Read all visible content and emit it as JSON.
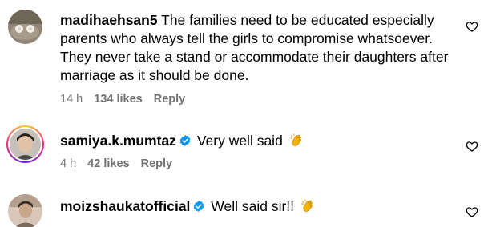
{
  "comments": [
    {
      "username": "madihaehsan5",
      "verified": false,
      "text": "The families need to be educated especially parents who always tell the girls to compromise whatsoever. They never take a stand or accommodate their daughters after marriage as it should be done.",
      "time": "14 h",
      "likes": "134 likes",
      "reply": "Reply"
    },
    {
      "username": "samiya.k.mumtaz",
      "verified": true,
      "text": "Very well said",
      "emoji": "clapping-hands-icon",
      "time": "4 h",
      "likes": "42 likes",
      "reply": "Reply"
    },
    {
      "username": "moizshaukatofficial",
      "verified": true,
      "text": "Well said sir!!",
      "emoji": "clapping-hands-icon",
      "time": "",
      "likes": "",
      "reply": ""
    }
  ],
  "colors": {
    "text": "#000000",
    "meta": "#737373",
    "verified": "#0095f6",
    "clap": "#f4b400"
  }
}
